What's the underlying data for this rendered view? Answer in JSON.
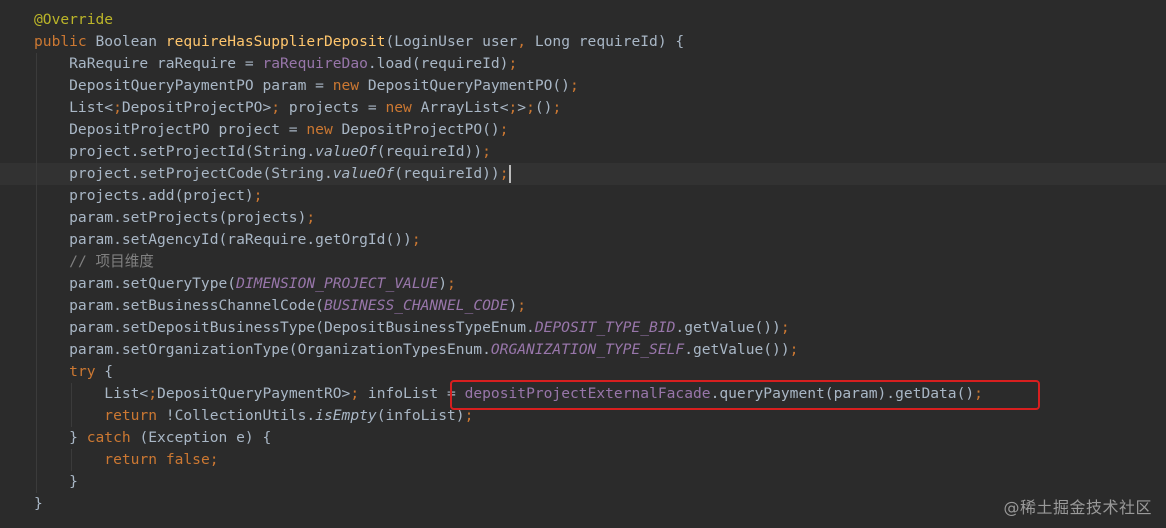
{
  "colors": {
    "background": "#2b2b2b",
    "text": "#a9b7c6",
    "keyword": "#cc7832",
    "method": "#ffc66d",
    "field": "#9876aa",
    "annotation": "#bbb529",
    "comment": "#808080",
    "highlight_box": "#d71f1f"
  },
  "code": {
    "lines": [
      "@Override",
      "public Boolean requireHasSupplierDeposit(LoginUser user, Long requireId) {",
      "    RaRequire raRequire = raRequireDao.load(requireId);",
      "    DepositQueryPaymentPO param = new DepositQueryPaymentPO();",
      "    List<DepositProjectPO> projects = new ArrayList<>();",
      "    DepositProjectPO project = new DepositProjectPO();",
      "    project.setProjectId(String.valueOf(requireId));",
      "    project.setProjectCode(String.valueOf(requireId));",
      "    projects.add(project);",
      "    param.setProjects(projects);",
      "    param.setAgencyId(raRequire.getOrgId());",
      "    // 项目维度",
      "    param.setQueryType(DIMENSION_PROJECT_VALUE);",
      "    param.setBusinessChannelCode(BUSINESS_CHANNEL_CODE);",
      "    param.setDepositBusinessType(DepositBusinessTypeEnum.DEPOSIT_TYPE_BID.getValue());",
      "    param.setOrganizationType(OrganizationTypesEnum.ORGANIZATION_TYPE_SELF.getValue());",
      "    try {",
      "        List<DepositQueryPaymentRO> infoList = depositProjectExternalFacade.queryPayment(param).getData();",
      "        return !CollectionUtils.isEmpty(infoList);",
      "    } catch (Exception e) {",
      "        return false;",
      "    }",
      "}"
    ]
  },
  "watermark": "@稀土掘金技术社区"
}
